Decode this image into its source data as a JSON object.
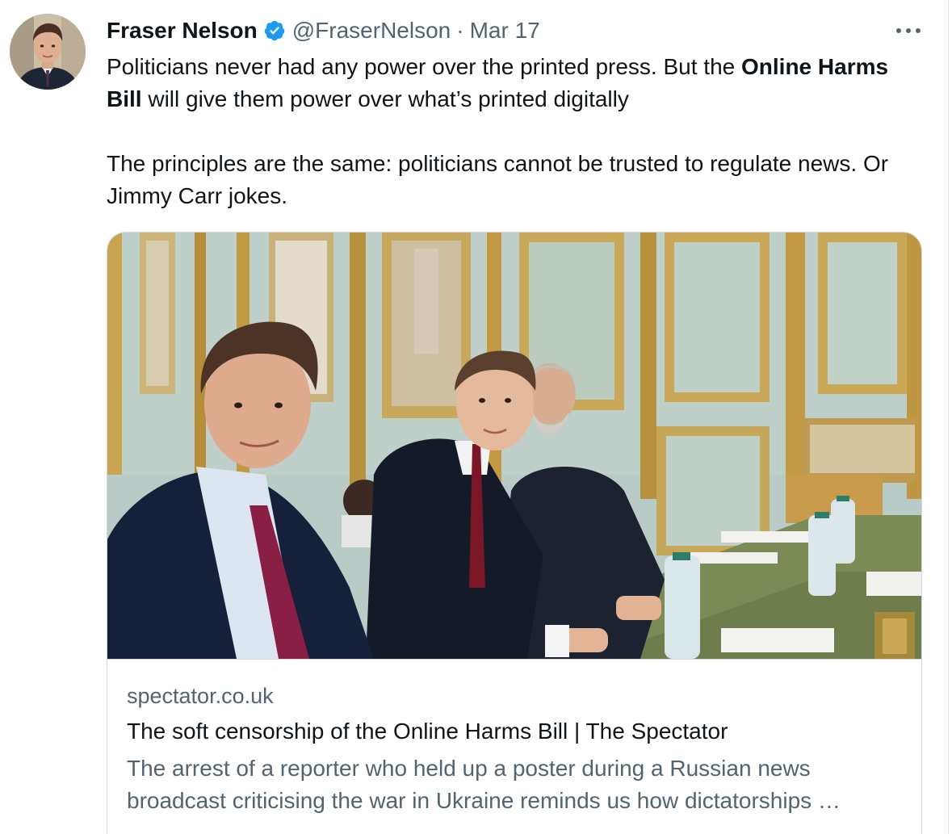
{
  "author": {
    "name": "Fraser Nelson",
    "handle": "@FraserNelson",
    "separator": "·",
    "date": "Mar 17",
    "verified": true
  },
  "tweet": {
    "line1_a": "Politicians never had any power over the printed press. But the ",
    "line1_bold": "Online Harms Bill",
    "line1_b": " will give them power over what’s printed digitally",
    "line2": "The principles are the same: politicians cannot be trusted to regulate news. Or Jimmy Carr jokes."
  },
  "card": {
    "domain": "spectator.co.uk",
    "title": "The soft censorship of the Online Harms Bill | The Spectator",
    "description": "The arrest of a reporter who held up a poster during a Russian news broadcast criticising the war in Ukraine reminds us how dictatorships …"
  },
  "colors": {
    "text_primary": "#0f1419",
    "text_secondary": "#536471",
    "verified_blue": "#1d9bf0",
    "border": "#cfd9de"
  },
  "icons": {
    "verified": "verified-badge-icon",
    "more": "more-horizontal-icon"
  }
}
